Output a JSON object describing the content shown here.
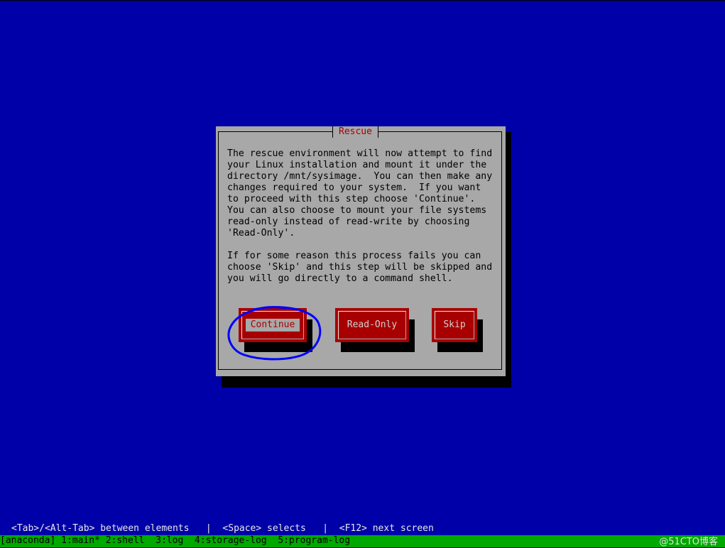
{
  "dialog": {
    "title": "Rescue",
    "body": "The rescue environment will now attempt to find\nyour Linux installation and mount it under the\ndirectory /mnt/sysimage.  You can then make any\nchanges required to your system.  If you want\nto proceed with this step choose 'Continue'.\nYou can also choose to mount your file systems\nread-only instead of read-write by choosing\n'Read-Only'.\n\nIf for some reason this process fails you can\nchoose 'Skip' and this step will be skipped and\nyou will go directly to a command shell.",
    "buttons": {
      "continue": "Continue",
      "read_only": "Read-Only",
      "skip": "Skip"
    },
    "focused_button": "continue"
  },
  "help_line": "<Tab>/<Alt-Tab> between elements   |  <Space> selects   |  <F12> next screen",
  "status_bar": {
    "text": "[anaconda] 1:main* 2:shell  3:log  4:storage-log  5:program-log",
    "watermark": "@51CTO博客"
  },
  "colors": {
    "background": "#0000a8",
    "dialog": "#a8a8a8",
    "button": "#a80000",
    "status_bar": "#00a800",
    "annotation": "#0000ff"
  }
}
